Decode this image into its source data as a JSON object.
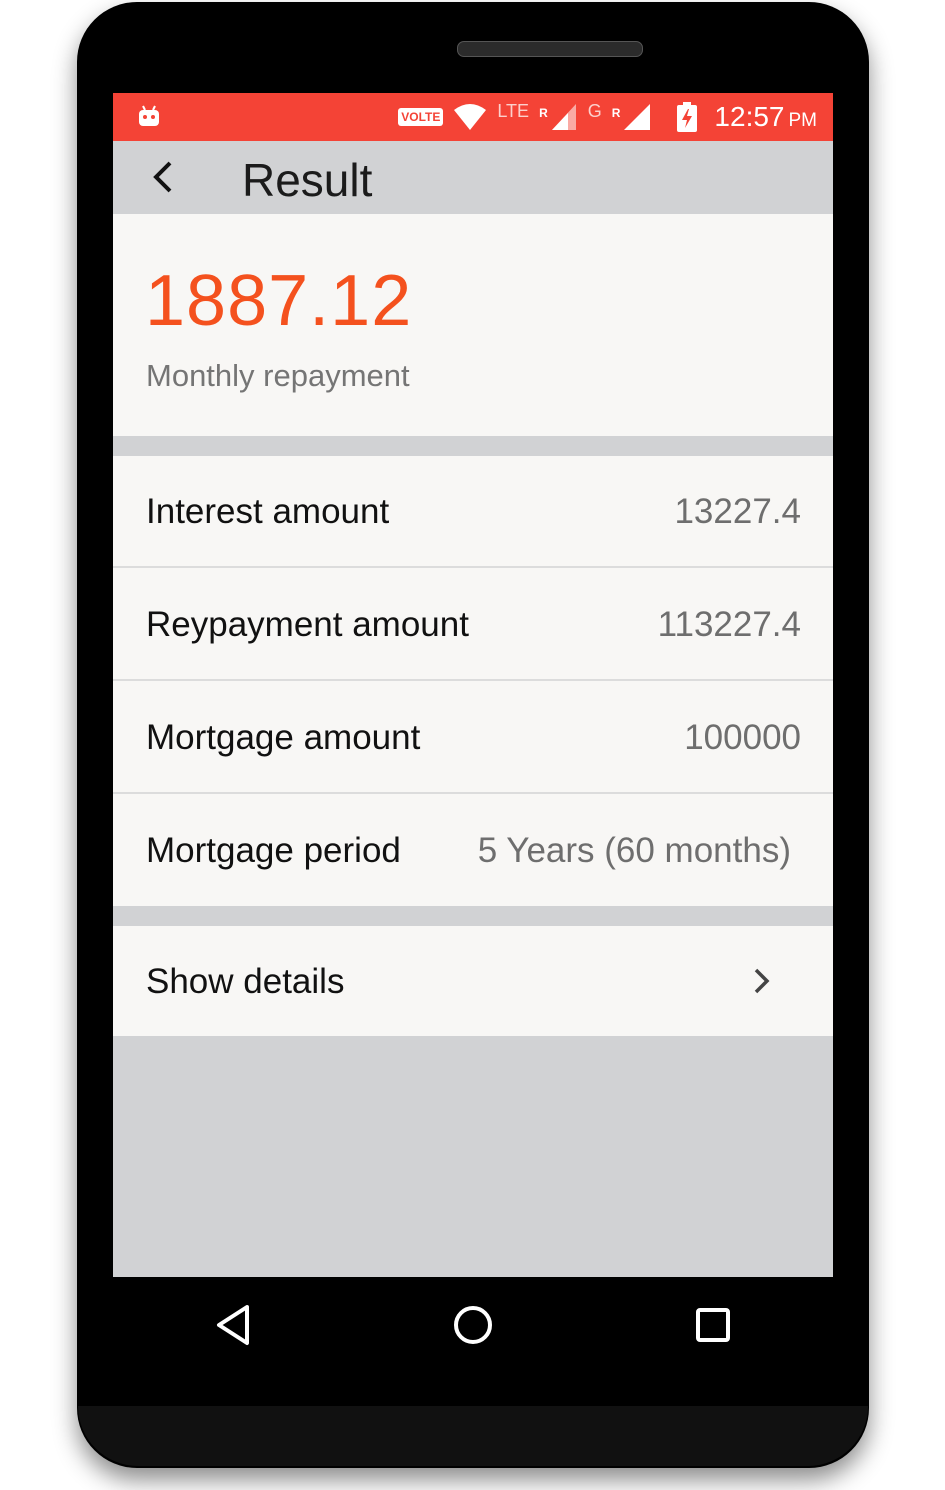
{
  "status_bar": {
    "icons": [
      "android-notification-icon",
      "volte-badge",
      "wifi-icon",
      "lte-signal-icon",
      "g-signal-icon",
      "battery-charging-icon"
    ],
    "volte_label": "VOLTE",
    "lte_label": "LTE",
    "roaming_label": "R",
    "g_label": "G",
    "time": "12:57",
    "ampm": "PM",
    "color": "#f44336"
  },
  "app_bar": {
    "title": "Result",
    "back_icon": "chevron-left-icon"
  },
  "result": {
    "value": "1887.12",
    "label": "Monthly repayment",
    "accent_color": "#f4511e"
  },
  "summary": {
    "rows": [
      {
        "label": "Interest amount",
        "value": "13227.4"
      },
      {
        "label": "Reypayment amount",
        "value": "113227.4"
      },
      {
        "label": "Mortgage amount",
        "value": "100000"
      },
      {
        "label": "Mortgage period",
        "value": "5 Years (60 months)"
      }
    ]
  },
  "details": {
    "label": "Show details",
    "icon": "chevron-right-icon"
  },
  "nav_bar": {
    "buttons": [
      "back-triangle-icon",
      "home-circle-icon",
      "recents-square-icon"
    ]
  }
}
